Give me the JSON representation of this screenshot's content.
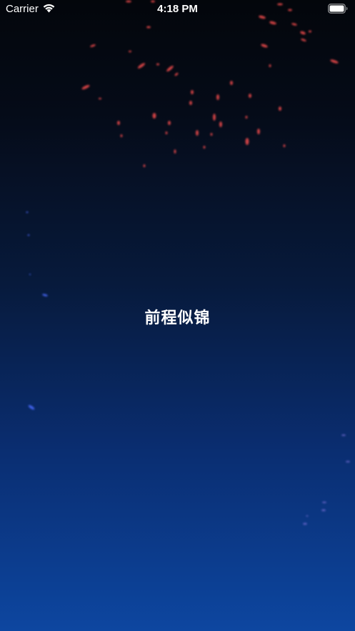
{
  "status_bar": {
    "carrier": "Carrier",
    "time": "4:18 PM"
  },
  "main": {
    "title": "前程似锦"
  },
  "colors": {
    "spark_red": "#ff4a4a",
    "spark_blue": "#4a6bff",
    "gradient_top": "#03060b",
    "gradient_bottom": "#0d46a0"
  },
  "icons": [
    "wifi-icon",
    "battery-icon"
  ]
}
